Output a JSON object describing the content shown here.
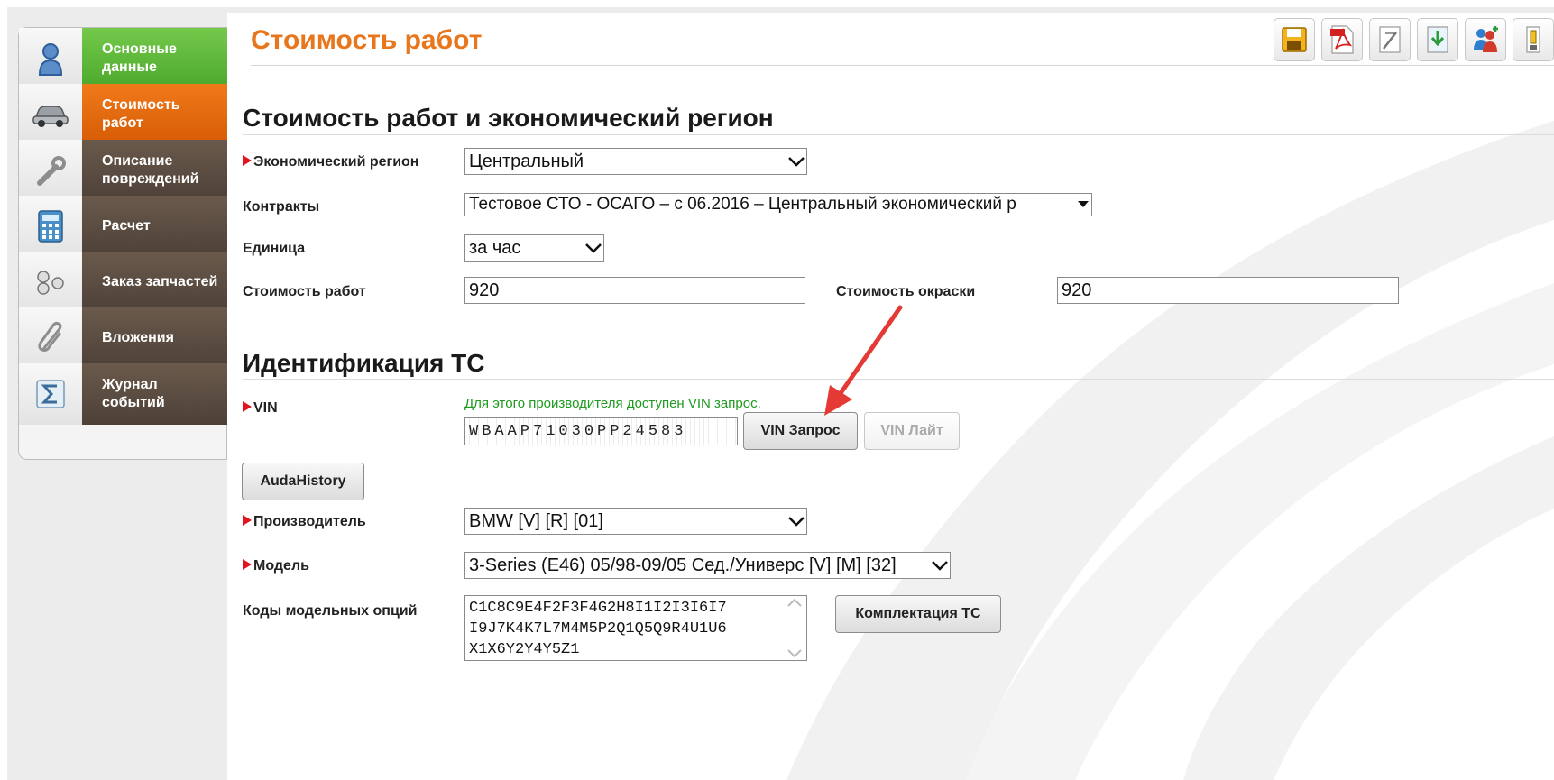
{
  "nav": {
    "items": [
      {
        "label": "Основные данные",
        "icon": "person-icon",
        "style": "green"
      },
      {
        "label": "Стоимость работ",
        "icon": "car-icon",
        "style": "orange",
        "active": true
      },
      {
        "label": "Описание повреждений",
        "icon": "wrench-icon",
        "style": "brown"
      },
      {
        "label": "Расчет",
        "icon": "calculator-icon",
        "style": "brown"
      },
      {
        "label": "Заказ запчастей",
        "icon": "parts-icon",
        "style": "brown"
      },
      {
        "label": "Вложения",
        "icon": "paperclip-icon",
        "style": "brown"
      },
      {
        "label": "Журнал событий",
        "icon": "sigma-icon",
        "style": "brown"
      }
    ]
  },
  "header": {
    "title": "Стоимость работ",
    "toolbar": [
      "save-icon",
      "pdf-icon",
      "edit-icon",
      "download-icon",
      "users-icon",
      "archive-icon"
    ]
  },
  "labor": {
    "section_title": "Стоимость работ и экономический регион",
    "region_label": "Экономический регион",
    "region_value": "Центральный",
    "contracts_label": "Контракты",
    "contracts_value": "Тестовое СТО - ОСАГО – с 06.2016 –  Центральный экономический р",
    "unit_label": "Единица",
    "unit_value": "за час",
    "labor_cost_label": "Стоимость работ",
    "labor_cost_value": "920",
    "paint_cost_label": "Стоимость окраски",
    "paint_cost_value": "920"
  },
  "vehicle": {
    "section_title": "Идентификация ТС",
    "vin_label": "VIN",
    "vin_hint": "Для этого производителя доступен VIN запрос.",
    "vin_value": "WBAAP71030PP24583",
    "vin_request_button": "VIN Запрос",
    "vin_lite_button": "VIN Лайт",
    "audahistory_button": "AudaHistory",
    "manufacturer_label": "Производитель",
    "manufacturer_value": "BMW [V] [R] [01]",
    "model_label": "Модель",
    "model_value": "3-Series (E46) 05/98-09/05 Сед./Универс [V] [M] [32]",
    "option_codes_label": "Коды модельных опций",
    "option_codes_lines": [
      "C1C8C9E4F2F3F4G2H8I1I2I3I6I7",
      "I9J7K4K7L7M4M5P2Q1Q5Q9R4U1U6",
      "X1X6Y2Y4Y5Z1"
    ],
    "equipment_button": "Комплектация ТС"
  },
  "colors": {
    "accent": "#e8761c",
    "nav_green": "#4ba82b",
    "nav_orange": "#d65b05",
    "nav_brown": "#4d4037",
    "hint_green": "#1e9a1e",
    "required_marker": "#e0141e",
    "annotation_arrow": "#e53935"
  }
}
